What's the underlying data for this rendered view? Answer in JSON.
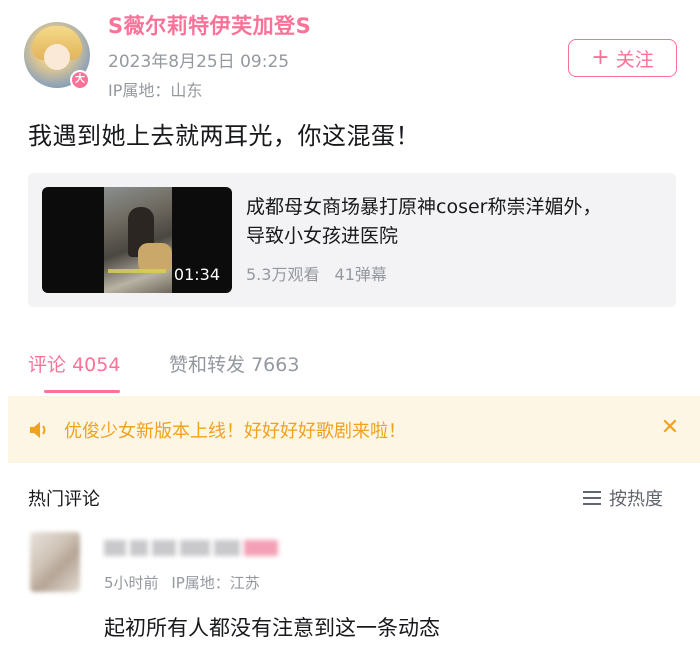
{
  "post": {
    "username": "S薇尔莉特伊芙加登S",
    "time": "2023年8月25日 09:25",
    "ip_location": "IP属地：山东",
    "avatar_badge": "大",
    "follow_label": "关注",
    "text": "我遇到她上去就两耳光，你这混蛋！"
  },
  "video": {
    "title": "成都母女商场暴打原神coser称崇洋媚外，导致小女孩进医院",
    "views": "5.3万观看",
    "danmaku": "41弹幕",
    "duration": "01:34"
  },
  "tabs": [
    {
      "label": "评论",
      "count": "4054",
      "active": true
    },
    {
      "label": "赞和转发",
      "count": "7663",
      "active": false
    }
  ],
  "notice": {
    "text": "优俊少女新版本上线！好好好好歌剧来啦！"
  },
  "comments_section": {
    "title": "热门评论",
    "sort_label": "按热度"
  },
  "comment": {
    "time": "5小时前",
    "ip_location": "IP属地：江苏",
    "text": "起初所有人都没有注意到这一条动态"
  },
  "colors": {
    "accent": "#fb7299",
    "muted": "#9499a0",
    "notice_text": "#f0a21e",
    "notice_bg": "#fdf6e4",
    "card_bg": "#f3f3f5"
  },
  "icons": [
    "plus-icon",
    "speaker-icon",
    "close-icon",
    "sort-lines-icon"
  ]
}
